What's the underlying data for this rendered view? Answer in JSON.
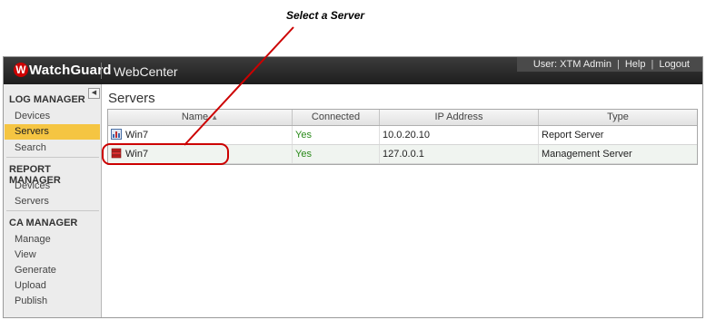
{
  "annotation": {
    "callout": "Select a Server"
  },
  "header": {
    "logo_text": "WatchGuard",
    "app_name": "WebCenter",
    "user_label": "User: XTM Admin",
    "help": "Help",
    "logout": "Logout"
  },
  "sidebar": {
    "collapse_glyph": "◀",
    "log_manager": {
      "title": "LOG MANAGER",
      "items": [
        "Devices",
        "Servers",
        "Search"
      ],
      "active": "Servers"
    },
    "report_manager": {
      "title": "REPORT MANAGER",
      "items": [
        "Devices",
        "Servers"
      ]
    },
    "ca_manager": {
      "title": "CA MANAGER",
      "items": [
        "Manage",
        "View",
        "Generate",
        "Upload",
        "Publish"
      ]
    }
  },
  "main": {
    "title": "Servers",
    "columns": [
      "Name",
      "Connected",
      "IP Address",
      "Type"
    ],
    "sort_glyph": "▲",
    "rows": [
      {
        "name": "Win7",
        "connected": "Yes",
        "ip": "10.0.20.10",
        "type": "Report Server",
        "icon": "report-server-icon"
      },
      {
        "name": "Win7",
        "connected": "Yes",
        "ip": "127.0.0.1",
        "type": "Management Server",
        "icon": "management-server-icon"
      }
    ]
  },
  "colors": {
    "active_nav": "#f5c542",
    "annotation": "#cc0000",
    "connected_yes": "#2a8a1a"
  }
}
